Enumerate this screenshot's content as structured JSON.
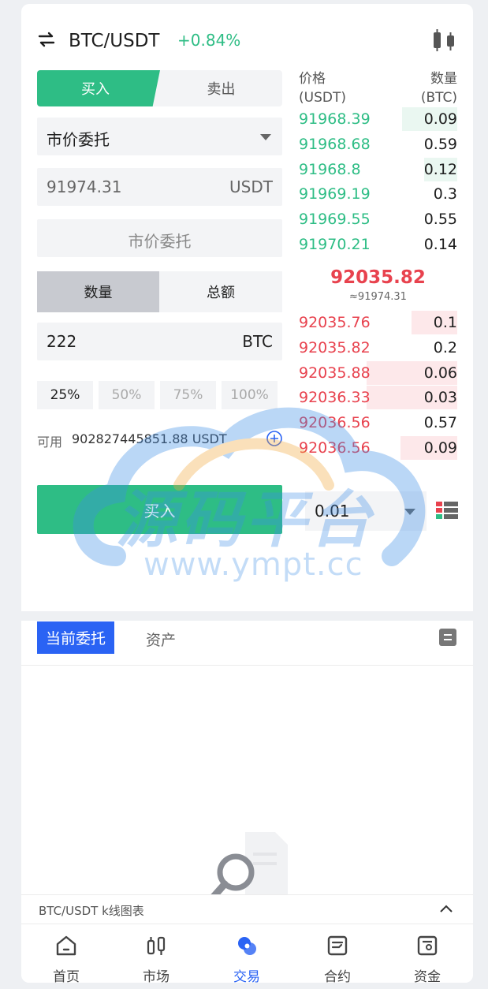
{
  "header": {
    "pair": "BTC/USDT",
    "change": "+0.84%",
    "swap_icon": "swap-arrows-icon",
    "chart_icon": "candlestick-icon"
  },
  "trade": {
    "buy_tab": "买入",
    "sell_tab": "卖出",
    "order_type": "市价委托",
    "price_value": "91974.31",
    "price_unit": "USDT",
    "market_label": "市价委托",
    "amount_tab": "数量",
    "total_tab": "总额",
    "qty_value": "222",
    "qty_unit": "BTC",
    "percents": [
      "25%",
      "50%",
      "75%",
      "100%"
    ],
    "available_label": "可用",
    "available_value": "902827445851.88 USDT",
    "buy_button": "买入"
  },
  "orderbook": {
    "price_header": "价格",
    "price_unit": "(USDT)",
    "qty_header": "数量",
    "qty_unit": "(BTC)",
    "bids": [
      {
        "price": "91968.39",
        "qty": "0.09",
        "depth": 0.35
      },
      {
        "price": "91968.68",
        "qty": "0.59",
        "depth": 0.0
      },
      {
        "price": "91968.8",
        "qty": "0.12",
        "depth": 0.21
      },
      {
        "price": "91969.19",
        "qty": "0.3",
        "depth": 0.0
      },
      {
        "price": "91969.55",
        "qty": "0.55",
        "depth": 0.0
      },
      {
        "price": "91970.21",
        "qty": "0.14",
        "depth": 0.0
      }
    ],
    "last_price": "92035.82",
    "last_approx": "≈91974.31",
    "asks": [
      {
        "price": "92035.76",
        "qty": "0.1",
        "depth": 0.29
      },
      {
        "price": "92035.82",
        "qty": "0.2",
        "depth": 0.0
      },
      {
        "price": "92035.88",
        "qty": "0.06",
        "depth": 0.57
      },
      {
        "price": "92036.33",
        "qty": "0.03",
        "depth": 0.57
      },
      {
        "price": "92036.56",
        "qty": "0.57",
        "depth": 0.0
      },
      {
        "price": "92036.56",
        "qty": "0.09",
        "depth": 0.36
      }
    ],
    "depth_value": "0.01"
  },
  "watermark": {
    "title": "源码平台",
    "url": "www.ympt.cc"
  },
  "orders": {
    "tab_current": "当前委托",
    "tab_assets": "资产"
  },
  "kline": {
    "label": "BTC/USDT k线图表"
  },
  "nav": {
    "items": [
      {
        "label": "首页",
        "icon": "home-icon"
      },
      {
        "label": "市场",
        "icon": "market-icon"
      },
      {
        "label": "交易",
        "icon": "trade-icon"
      },
      {
        "label": "合约",
        "icon": "contract-icon"
      },
      {
        "label": "资金",
        "icon": "wallet-icon"
      }
    ]
  },
  "colors": {
    "buy_green": "#2ebd85",
    "sell_red": "#e8424e",
    "accent_blue": "#2a63f4"
  }
}
